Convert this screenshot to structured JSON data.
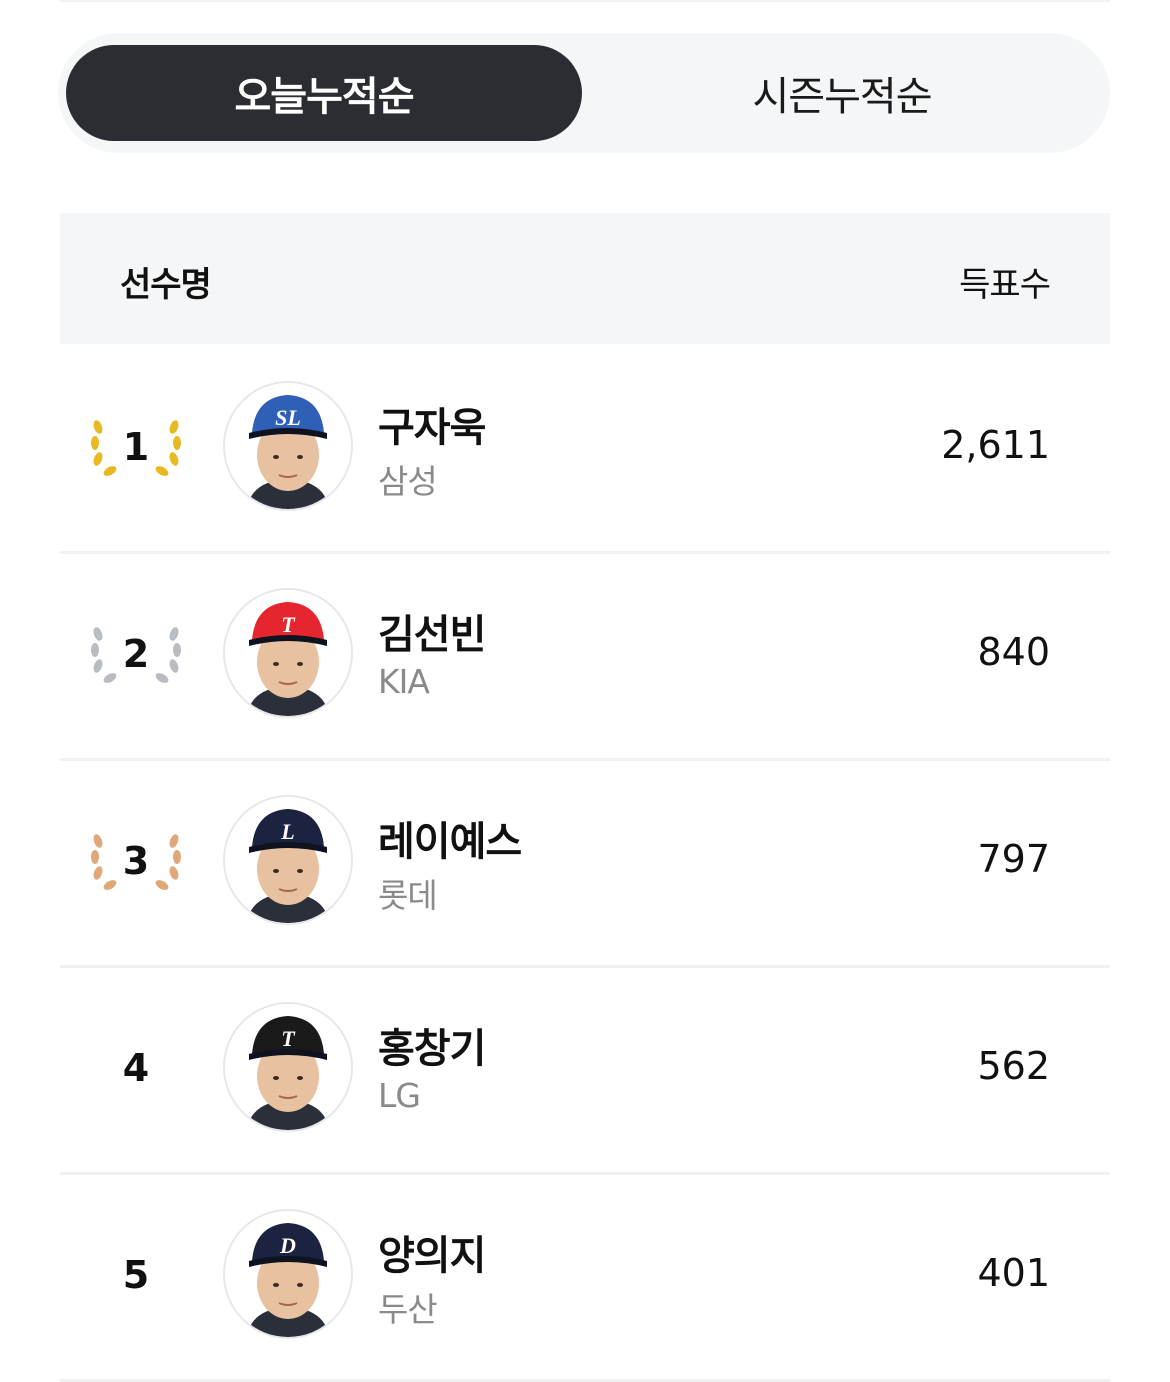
{
  "tabs": {
    "today": "오늘누적순",
    "season": "시즌누적순"
  },
  "table": {
    "col_player": "선수명",
    "col_votes": "득표수"
  },
  "colors": {
    "gold": "#e8b923",
    "silver": "#b9bcc2",
    "bronze": "#e0a878"
  },
  "players": [
    {
      "rank": "1",
      "name": "구자욱",
      "team": "삼성",
      "votes": "2,611",
      "medal": "gold",
      "cap": "#2f5fb7",
      "logo": "SL"
    },
    {
      "rank": "2",
      "name": "김선빈",
      "team": "KIA",
      "votes": "840",
      "medal": "silver",
      "cap": "#e6262f",
      "logo": "T"
    },
    {
      "rank": "3",
      "name": "레이예스",
      "team": "롯데",
      "votes": "797",
      "medal": "bronze",
      "cap": "#1b2340",
      "logo": "L"
    },
    {
      "rank": "4",
      "name": "홍창기",
      "team": "LG",
      "votes": "562",
      "medal": "",
      "cap": "#1a1a1a",
      "logo": "T"
    },
    {
      "rank": "5",
      "name": "양의지",
      "team": "두산",
      "votes": "401",
      "medal": "",
      "cap": "#1b2340",
      "logo": "D"
    }
  ]
}
